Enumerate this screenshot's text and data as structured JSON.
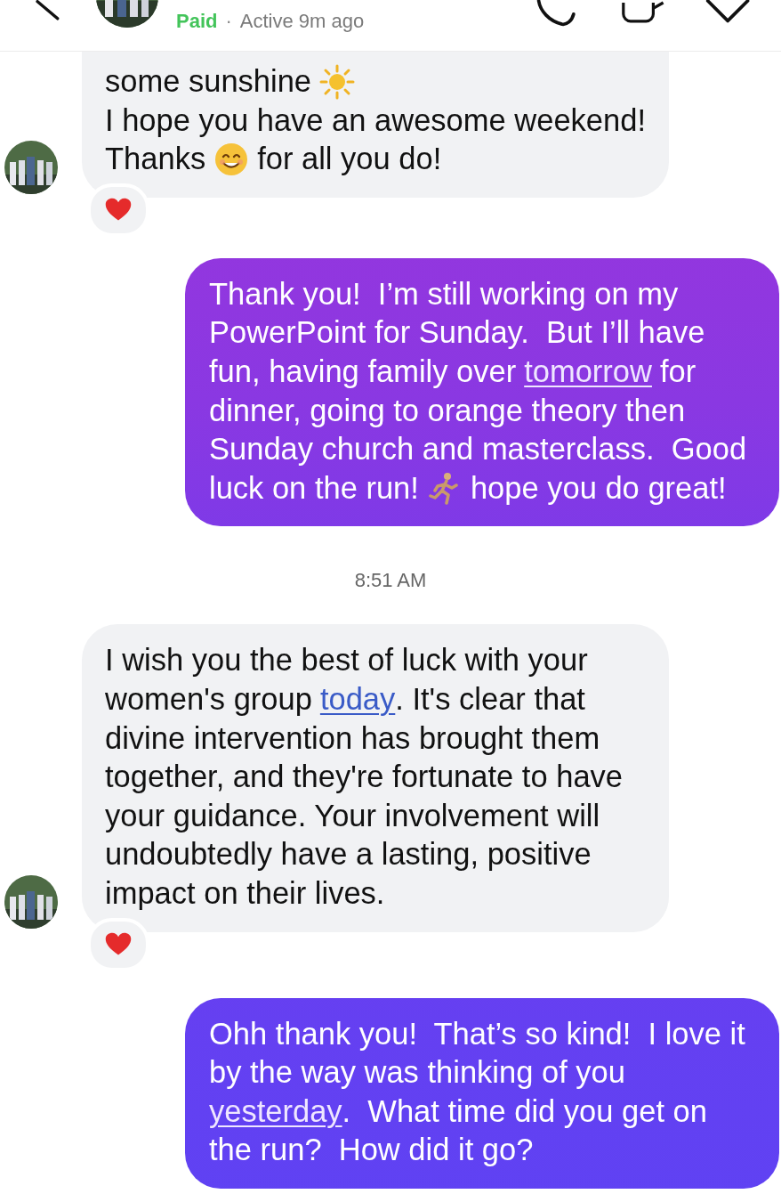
{
  "header": {
    "status": "Paid",
    "separator": "·",
    "activity": "Active 9m ago"
  },
  "messages": [
    {
      "kind": "incoming",
      "continued": true,
      "avatar": true,
      "reaction": true,
      "lines": [
        [
          {
            "kind": "text",
            "text": "some sunshine"
          },
          {
            "kind": "sun"
          }
        ],
        [
          {
            "kind": "text",
            "text": "I hope you have an awesome weekend!"
          }
        ],
        [
          {
            "kind": "text",
            "text": "Thanks"
          },
          {
            "kind": "smile"
          },
          {
            "kind": "text",
            "text": "for all you do!"
          }
        ]
      ]
    },
    {
      "kind": "outgoing",
      "continued": false,
      "avatar": false,
      "reaction": false,
      "lines": [
        [
          {
            "kind": "text",
            "text": "Thank you!  I’m still working on my"
          }
        ],
        [
          {
            "kind": "text",
            "text": "PowerPoint for Sunday.  But I’ll have"
          }
        ],
        [
          {
            "kind": "text",
            "text": "fun, having family over"
          },
          {
            "kind": "link",
            "text": "tomorrow"
          },
          {
            "kind": "text",
            "text": "for"
          }
        ],
        [
          {
            "kind": "text",
            "text": "dinner, going to orange theory then"
          }
        ],
        [
          {
            "kind": "text",
            "text": "Sunday church and masterclass.  Good"
          }
        ],
        [
          {
            "kind": "text",
            "text": "luck on the run!"
          },
          {
            "kind": "runner"
          },
          {
            "kind": "text",
            "text": "hope you do great!"
          }
        ]
      ]
    },
    {
      "kind": "time",
      "text": "8:51 AM"
    },
    {
      "kind": "incoming",
      "continued": false,
      "avatar": true,
      "reaction": true,
      "lines": [
        [
          {
            "kind": "text",
            "text": "I wish you the best of luck with your"
          }
        ],
        [
          {
            "kind": "text",
            "text": "women's group"
          },
          {
            "kind": "link",
            "text": "today"
          },
          {
            "kind": "text",
            "text": ". It's clear that",
            "tight": true
          }
        ],
        [
          {
            "kind": "text",
            "text": "divine intervention has brought them"
          }
        ],
        [
          {
            "kind": "text",
            "text": "together, and they're fortunate to have"
          }
        ],
        [
          {
            "kind": "text",
            "text": "your guidance. Your involvement will"
          }
        ],
        [
          {
            "kind": "text",
            "text": "undoubtedly have a lasting, positive"
          }
        ],
        [
          {
            "kind": "text",
            "text": "impact on their lives."
          }
        ]
      ]
    },
    {
      "kind": "outgoing",
      "continued": false,
      "avatar": false,
      "reaction": false,
      "lines": [
        [
          {
            "kind": "text",
            "text": "Ohh thank you!  That’s so kind!  I love it"
          }
        ],
        [
          {
            "kind": "text",
            "text": "by the way was thinking of you"
          }
        ],
        [
          {
            "kind": "link",
            "text": "yesterday"
          },
          {
            "kind": "text",
            "text": ".  What time did you get on",
            "tight": true
          }
        ],
        [
          {
            "kind": "text",
            "text": "the run?  How did it go?"
          }
        ]
      ]
    }
  ]
}
